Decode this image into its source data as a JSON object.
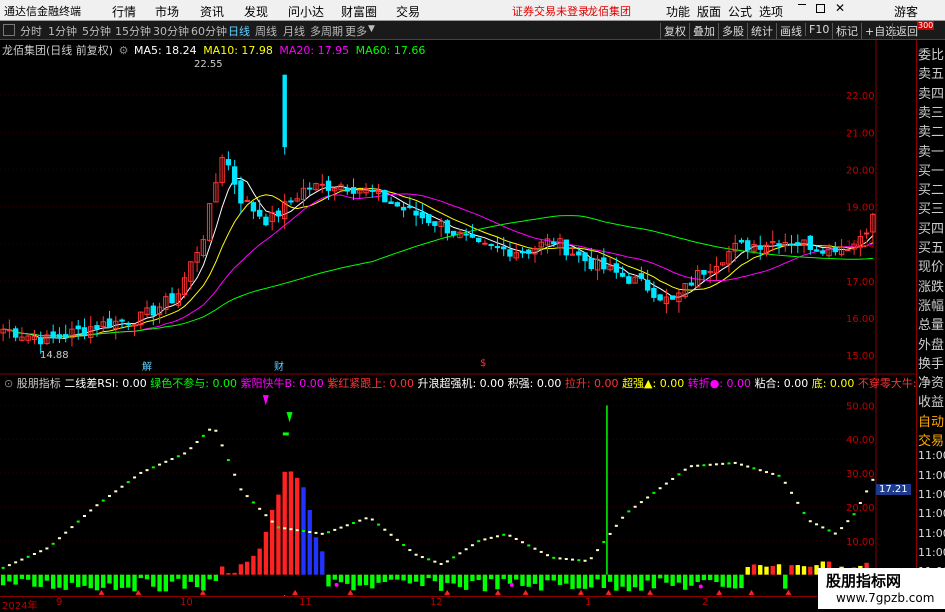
{
  "menubar": {
    "app_title": "通达信金融终端",
    "menus": [
      "行情",
      "市场",
      "资讯",
      "发现",
      "问小达",
      "财富圈",
      "交易"
    ],
    "notice": "证券交易未登录",
    "stock_name": "龙佰集团",
    "right_items": [
      "功能",
      "版面",
      "公式",
      "选项"
    ],
    "user": "游客"
  },
  "toolbar": {
    "periods": [
      "分时",
      "1分钟",
      "5分钟",
      "15分钟",
      "30分钟",
      "60分钟",
      "日线",
      "周线",
      "月线",
      "多周期",
      "更多"
    ],
    "active": "日线",
    "right": [
      "复权",
      "叠加",
      "多股",
      "统计",
      "画线",
      "F10",
      "标记",
      "+自选",
      "返回"
    ]
  },
  "main_chart": {
    "title": "龙佰集团(日线 前复权)",
    "ma": [
      {
        "label": "MA5: 18.24",
        "color": "#ffffff"
      },
      {
        "label": "MA10: 17.98",
        "color": "#ffff00"
      },
      {
        "label": "MA20: 17.95",
        "color": "#ff00ff"
      },
      {
        "label": "MA60: 17.66",
        "color": "#00ff00"
      }
    ],
    "high_label": "22.55",
    "low_label": "14.88",
    "event_marks": [
      "解",
      "财",
      "$"
    ]
  },
  "indicator": {
    "name": "股朋指标",
    "items": [
      {
        "label": "二线差RSI: 0.00",
        "color": "#ffffff"
      },
      {
        "label": "绿色不参与: 0.00",
        "color": "#00ff00"
      },
      {
        "label": "紫阳快牛B: 0.00",
        "color": "#ff00ff"
      },
      {
        "label": "紫红紧跟上: 0.00",
        "color": "#ff3333"
      },
      {
        "label": "升浪超强机: 0.00",
        "color": "#ffffff"
      },
      {
        "label": "积强: 0.00",
        "color": "#ffffff"
      },
      {
        "label": "拉升: 0.00",
        "color": "#ff3333"
      },
      {
        "label": "超强▲: 0.00",
        "color": "#ffff00"
      },
      {
        "label": "转折●: 0.00",
        "color": "#ff00ff"
      },
      {
        "label": "粘合: 0.00",
        "color": "#ffffff"
      },
      {
        "label": "底: 0.00",
        "color": "#ffff00"
      },
      {
        "label": "不穿零大牛: 0.00",
        "color": "#ff3333"
      }
    ],
    "value_badge": "17.21"
  },
  "side_panel": {
    "top_tag": "300",
    "items": [
      "委比",
      "卖五",
      "卖四",
      "卖三",
      "卖二",
      "卖一",
      "买一",
      "买二",
      "买三",
      "买四",
      "买五",
      "现价",
      "涨跌",
      "涨幅",
      "总量",
      "外盘",
      "换手",
      "净资",
      "收益",
      "自动",
      "交易",
      "11:00",
      "11:00",
      "11:00",
      "11:00",
      "11:00",
      "11:00",
      "11:00",
      "11:00"
    ]
  },
  "time_axis": [
    "2024年",
    "9",
    "10",
    "11",
    "12",
    "1",
    "2",
    "3"
  ],
  "watermark": {
    "line1": "股朋指标网",
    "line2": "www.7gpzb.com"
  },
  "chart_data": {
    "type": "candlestick",
    "price_axis": [
      22.0,
      21.0,
      20.0,
      19.0,
      18.0,
      17.0,
      16.0,
      15.0
    ],
    "indicator_axis": [
      50.0,
      40.0,
      30.0,
      20.0,
      10.0,
      0.0
    ],
    "ylim_price": [
      14.6,
      23.0
    ],
    "ylim_indicator": [
      -6,
      56
    ]
  },
  "colors": {
    "up": "#ff3333",
    "down": "#00e5ff",
    "bg": "#000000",
    "grid": "#550000"
  }
}
